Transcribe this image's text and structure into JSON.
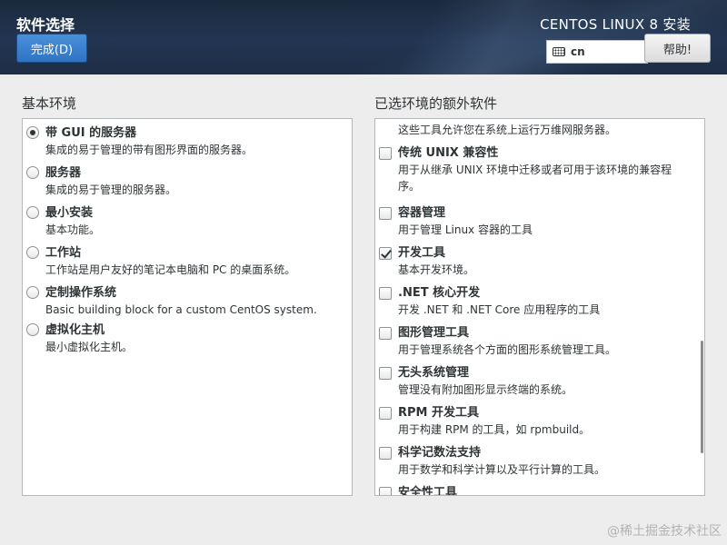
{
  "header": {
    "title": "软件选择",
    "done_label": "完成(D)",
    "product_title": "CENTOS LINUX 8 安装",
    "keyboard_layout": "cn",
    "help_label": "帮助!"
  },
  "base_env": {
    "label": "基本环境",
    "items": [
      {
        "name": "带 GUI 的服务器",
        "desc": "集成的易于管理的带有图形界面的服务器。",
        "selected": true
      },
      {
        "name": "服务器",
        "desc": "集成的易于管理的服务器。",
        "selected": false
      },
      {
        "name": "最小安装",
        "desc": "基本功能。",
        "selected": false
      },
      {
        "name": "工作站",
        "desc": "工作站是用户友好的笔记本电脑和 PC 的桌面系统。",
        "selected": false
      },
      {
        "name": "定制操作系统",
        "desc": "Basic building block for a custom CentOS system.",
        "selected": false
      },
      {
        "name": "虚拟化主机",
        "desc": "最小虚拟化主机。",
        "selected": false
      }
    ]
  },
  "addons": {
    "label": "已选环境的额外软件",
    "partial_top_desc": "这些工具允许您在系统上运行万维网服务器。",
    "items": [
      {
        "name": "传统 UNIX 兼容性",
        "desc_line1": "用于从继承 UNIX 环境中迁移或者可用于该环境的兼容程",
        "desc_line2": "序。",
        "checked": false
      },
      {
        "name": "容器管理",
        "desc_line1": "用于管理 Linux 容器的工具",
        "checked": false
      },
      {
        "name": "开发工具",
        "desc_line1": "基本开发环境。",
        "checked": true
      },
      {
        "name": ".NET 核心开发",
        "desc_line1": "开发 .NET 和 .NET Core 应用程序的工具",
        "checked": false
      },
      {
        "name": "图形管理工具",
        "desc_line1": "用于管理系统各个方面的图形系统管理工具。",
        "checked": false
      },
      {
        "name": "无头系统管理",
        "desc_line1": "管理没有附加图形显示终端的系统。",
        "checked": false
      },
      {
        "name": "RPM 开发工具",
        "desc_line1": "用于构建 RPM 的工具，如 rpmbuild。",
        "checked": false
      },
      {
        "name": "科学记数法支持",
        "desc_line1": "用于数学和科学计算以及平行计算的工具。",
        "checked": false
      },
      {
        "name": "安全性工具",
        "checked": false
      }
    ]
  },
  "watermark": "@稀土掘金技术社区"
}
